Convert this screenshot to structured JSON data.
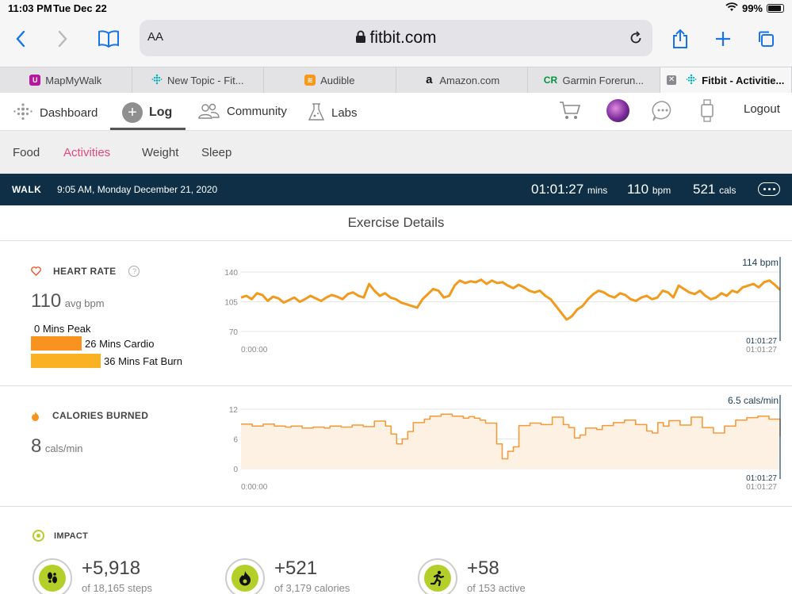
{
  "status": {
    "time": "11:03 PM",
    "date": "Tue Dec 22",
    "battery": "99%"
  },
  "browser": {
    "aa": "AA",
    "host": "fitbit.com"
  },
  "tabs": [
    {
      "label": "MapMyWalk",
      "color": "#b5179e"
    },
    {
      "label": "New Topic - Fit...",
      "color": "#00b0b9"
    },
    {
      "label": "Audible",
      "color": "#f7991c"
    },
    {
      "label": "Amazon.com",
      "color": "#111111"
    },
    {
      "label": "Garmin Forerun...",
      "color": "#009639"
    },
    {
      "label": "Fitbit - Activitie...",
      "color": "#00b0b9"
    }
  ],
  "nav": {
    "dashboard": "Dashboard",
    "log": "Log",
    "community": "Community",
    "labs": "Labs",
    "logout": "Logout"
  },
  "subnav": {
    "food": "Food",
    "activities": "Activities",
    "weight": "Weight",
    "sleep": "Sleep"
  },
  "activity": {
    "type": "WALK",
    "when": "9:05 AM, Monday December 21, 2020",
    "duration": "01:01:27",
    "duration_unit": "mins",
    "bpm": "110",
    "bpm_unit": "bpm",
    "cals": "521",
    "cals_unit": "cals"
  },
  "section_title": "Exercise Details",
  "heart": {
    "label": "HEART RATE",
    "avg": "110",
    "avg_unit": "avg bpm",
    "zones": [
      {
        "label": "0 Mins Peak",
        "minutes": 0,
        "color": "#f2542d"
      },
      {
        "label": "26 Mins Cardio",
        "minutes": 26,
        "color": "#f7931e"
      },
      {
        "label": "36 Mins Fat Burn",
        "minutes": 36,
        "color": "#fbb124"
      }
    ],
    "current": "114 bpm",
    "x_start": "0:00:00",
    "x_end": "01:01:27"
  },
  "calories": {
    "label": "CALORIES BURNED",
    "value": "8",
    "unit": "cals/min",
    "current": "6.5 cals/min",
    "x_start": "0:00:00",
    "x_end": "01:01:27"
  },
  "impact": {
    "label": "IMPACT",
    "items": [
      {
        "value": "+5,918",
        "sub": "of 18,165 steps",
        "icon": "footprints-icon"
      },
      {
        "value": "+521",
        "sub": "of 3,179 calories",
        "icon": "flame-icon"
      },
      {
        "value": "+58",
        "sub": "of 153 active",
        "icon": "running-person-icon"
      }
    ]
  },
  "chart_data": [
    {
      "type": "line",
      "title": "HEART RATE",
      "ylabel": "bpm",
      "yticks": [
        70,
        105,
        140
      ],
      "ylim": [
        70,
        140
      ],
      "x": [
        "0:00:00",
        "01:01:27"
      ],
      "series": [
        {
          "values": [
            110,
            112,
            108,
            115,
            113,
            106,
            111,
            109,
            104,
            107,
            110,
            105,
            108,
            112,
            109,
            106,
            110,
            113,
            111,
            108,
            114,
            116,
            112,
            110,
            126,
            118,
            112,
            115,
            110,
            108,
            104,
            102,
            100,
            98,
            108,
            114,
            120,
            118,
            110,
            112,
            124,
            130,
            127,
            129,
            128,
            131,
            126,
            130,
            127,
            128,
            124,
            121,
            125,
            122,
            118,
            116,
            118,
            112,
            108,
            100,
            92,
            84,
            88,
            96,
            100,
            108,
            114,
            118,
            116,
            112,
            110,
            115,
            113,
            108,
            106,
            110,
            112,
            108,
            110,
            118,
            116,
            110,
            124,
            120,
            116,
            114,
            118,
            112,
            108,
            110,
            115,
            112,
            118,
            116,
            122,
            124,
            126,
            122,
            128,
            130,
            125,
            119
          ]
        }
      ]
    },
    {
      "type": "area",
      "title": "CALORIES BURNED",
      "ylabel": "cals/min",
      "yticks": [
        0,
        6,
        12
      ],
      "ylim": [
        0,
        12
      ],
      "x": [
        "0:00:00",
        "01:01:27"
      ],
      "series": [
        {
          "values": [
            9,
            9,
            8.6,
            8.6,
            9,
            9,
            8.6,
            8.6,
            8.4,
            8.6,
            8.6,
            8.2,
            8.2,
            8.4,
            8.4,
            8.2,
            8.6,
            8.6,
            8.4,
            8.4,
            8.8,
            8.8,
            8.5,
            8.5,
            9.6,
            9.6,
            8.6,
            7,
            5,
            6,
            7.5,
            9.3,
            9.3,
            10,
            10.6,
            10.6,
            11,
            11,
            10.6,
            10.6,
            10.2,
            10.5,
            10.2,
            9.8,
            9.2,
            9.2,
            5,
            2,
            3.5,
            4.4,
            8.7,
            8.7,
            9.2,
            9.2,
            8.9,
            8.9,
            10.4,
            10.4,
            8.9,
            8.3,
            6.2,
            6.8,
            8.2,
            8.2,
            7.9,
            8.7,
            8.7,
            9.3,
            9.3,
            9.8,
            9.8,
            8.9,
            8.9,
            7.6,
            7.2,
            9.3,
            8.6,
            9.7,
            9.7,
            8.8,
            8.8,
            10.4,
            10.4,
            8.3,
            8.3,
            7.2,
            7.2,
            8.6,
            8.6,
            9.8,
            9.8,
            10.3,
            10.3,
            10.6,
            10.6,
            10,
            10,
            6.5
          ]
        }
      ]
    }
  ]
}
